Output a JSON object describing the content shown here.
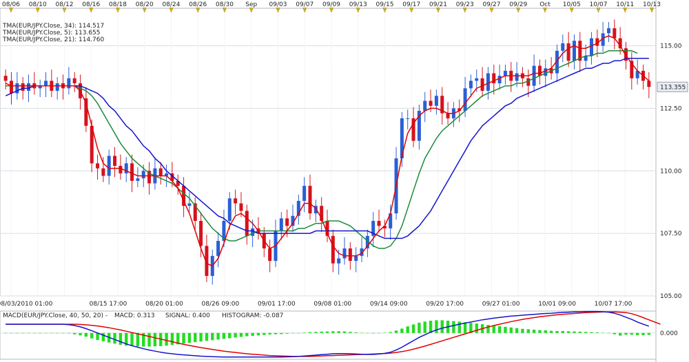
{
  "chart_data": {
    "type": "candlestick",
    "symbol": "EUR/JPY",
    "colors": {
      "up": "#2a5fd6",
      "down": "#d6121c",
      "tma5": "#e00000",
      "tma21": "#1a8a3a",
      "tma34": "#1414cc",
      "macd_line": "#1414cc",
      "signal_line": "#e00000",
      "histogram": "#22dd22",
      "grid": "#d9dde3",
      "marker": "#c8a000"
    },
    "top_axis_labels": [
      "08/06",
      "08/10",
      "08/12",
      "08/16",
      "08/18",
      "08/20",
      "08/24",
      "08/26",
      "08/30",
      "Sep",
      "09/03",
      "09/07",
      "09/09",
      "09/13",
      "09/15",
      "09/17",
      "09/21",
      "09/23",
      "09/27",
      "09/29",
      "Oct",
      "10/05",
      "10/07",
      "10/11",
      "10/13"
    ],
    "bottom_axis_labels": [
      "08/03/2010 01:00",
      "08/15 17:00",
      "08/20 01:00",
      "08/26 09:00",
      "09/01 17:00",
      "09/08 01:00",
      "09/14 09:00",
      "09/20 17:00",
      "09/27 01:00",
      "10/01 09:00",
      "10/07 17:00"
    ],
    "price_axis": {
      "ylim": [
        105,
        116.5
      ],
      "ticks": [
        "115.00",
        "112.50",
        "110.00",
        "107.50",
        "105.00"
      ],
      "tick_values": [
        115,
        112.5,
        110,
        107.5,
        105
      ],
      "last_price": "113.355",
      "last_value": 113.355
    },
    "legend": [
      {
        "text": "TMA(EUR/JPY.Close, 34): 114.517",
        "color": "#1414cc"
      },
      {
        "text": "TMA(EUR/JPY.Close, 5): 113.655",
        "color": "#e00000"
      },
      {
        "text": "TMA(EUR/JPY.Close, 21): 114.760",
        "color": "#1a8a3a"
      }
    ],
    "close": [
      113.6,
      113.1,
      113.5,
      113.2,
      113.5,
      113.3,
      113.4,
      113.6,
      113.2,
      113.5,
      113.3,
      113.7,
      113.5,
      112.9,
      111.8,
      110.3,
      110.1,
      109.8,
      110.6,
      110.2,
      109.9,
      110.3,
      109.6,
      109.7,
      110.0,
      109.5,
      110.1,
      109.8,
      109.9,
      109.6,
      109.4,
      108.6,
      108.7,
      108.0,
      107.0,
      105.8,
      106.6,
      107.2,
      108.0,
      108.9,
      108.7,
      108.4,
      107.4,
      107.7,
      107.5,
      106.9,
      106.4,
      107.6,
      108.1,
      107.8,
      108.2,
      108.8,
      109.4,
      108.3,
      108.6,
      108.0,
      107.4,
      106.3,
      106.5,
      106.9,
      106.4,
      106.6,
      106.9,
      107.4,
      108.0,
      107.8,
      107.7,
      108.3,
      110.5,
      112.1,
      112.1,
      111.2,
      112.4,
      112.8,
      112.6,
      113.0,
      112.3,
      112.1,
      112.5,
      112.4,
      113.3,
      113.6,
      113.7,
      113.2,
      113.9,
      113.5,
      113.8,
      114.0,
      113.6,
      113.9,
      113.7,
      113.4,
      114.2,
      113.8,
      114.1,
      113.9,
      114.8,
      115.1,
      114.4,
      115.2,
      114.4,
      114.6,
      115.3,
      115.0,
      115.5,
      115.7,
      115.3,
      114.9,
      114.4,
      113.7,
      114.0,
      113.6,
      113.355
    ],
    "tma5": [
      113.5,
      113.4,
      113.4,
      113.4,
      113.4,
      113.4,
      113.4,
      113.4,
      113.4,
      113.4,
      113.4,
      113.4,
      113.4,
      113.2,
      112.7,
      111.8,
      110.9,
      110.3,
      110.1,
      110.1,
      110.1,
      110.0,
      109.9,
      109.8,
      109.8,
      109.8,
      109.8,
      109.8,
      109.8,
      109.6,
      109.3,
      108.8,
      108.3,
      107.6,
      106.9,
      106.3,
      106.2,
      106.5,
      107.1,
      107.8,
      108.2,
      108.3,
      108.1,
      107.9,
      107.6,
      107.2,
      106.9,
      107.0,
      107.3,
      107.6,
      107.9,
      108.3,
      108.7,
      108.7,
      108.5,
      108.1,
      107.5,
      107.0,
      106.7,
      106.6,
      106.6,
      106.6,
      106.7,
      107.0,
      107.3,
      107.6,
      107.8,
      108.3,
      109.4,
      110.6,
      111.5,
      111.9,
      112.2,
      112.4,
      112.5,
      112.5,
      112.4,
      112.3,
      112.3,
      112.4,
      112.7,
      113.0,
      113.3,
      113.4,
      113.5,
      113.6,
      113.7,
      113.8,
      113.8,
      113.8,
      113.8,
      113.8,
      113.9,
      113.9,
      114.0,
      114.1,
      114.4,
      114.7,
      114.9,
      115.0,
      114.9,
      114.9,
      115.0,
      115.1,
      115.3,
      115.4,
      115.3,
      115.0,
      114.6,
      114.3,
      114.0,
      113.8,
      113.6
    ],
    "tma21": [
      113.4,
      113.4,
      113.4,
      113.4,
      113.4,
      113.4,
      113.4,
      113.4,
      113.4,
      113.4,
      113.4,
      113.4,
      113.4,
      113.3,
      113.2,
      113.0,
      112.7,
      112.3,
      111.9,
      111.5,
      111.1,
      110.8,
      110.5,
      110.3,
      110.1,
      109.9,
      109.8,
      109.7,
      109.6,
      109.5,
      109.3,
      109.1,
      108.9,
      108.6,
      108.3,
      108.0,
      107.7,
      107.5,
      107.3,
      107.2,
      107.2,
      107.3,
      107.4,
      107.5,
      107.6,
      107.6,
      107.6,
      107.6,
      107.6,
      107.6,
      107.6,
      107.7,
      107.7,
      107.8,
      107.9,
      107.9,
      108.0,
      108.0,
      108.0,
      107.9,
      107.8,
      107.6,
      107.4,
      107.2,
      107.0,
      106.9,
      106.9,
      107.0,
      107.3,
      107.8,
      108.5,
      109.2,
      109.9,
      110.5,
      110.9,
      111.3,
      111.6,
      111.8,
      112.0,
      112.2,
      112.4,
      112.6,
      112.8,
      113.0,
      113.1,
      113.2,
      113.3,
      113.4,
      113.4,
      113.5,
      113.5,
      113.6,
      113.7,
      113.8,
      113.9,
      114.0,
      114.1,
      114.2,
      114.3,
      114.4,
      114.5,
      114.6,
      114.6,
      114.7,
      114.7,
      114.8,
      114.8,
      114.8,
      114.8,
      114.8,
      114.7
    ],
    "tma34": [
      113.0,
      113.1,
      113.2,
      113.3,
      113.3,
      113.4,
      113.4,
      113.4,
      113.4,
      113.4,
      113.4,
      113.4,
      113.4,
      113.4,
      113.3,
      113.2,
      113.1,
      112.9,
      112.6,
      112.4,
      112.1,
      111.8,
      111.6,
      111.3,
      111.0,
      110.8,
      110.5,
      110.3,
      110.0,
      109.8,
      109.6,
      109.4,
      109.2,
      109.0,
      108.8,
      108.6,
      108.4,
      108.2,
      108.1,
      107.9,
      107.8,
      107.7,
      107.6,
      107.6,
      107.5,
      107.5,
      107.5,
      107.5,
      107.5,
      107.5,
      107.5,
      107.5,
      107.5,
      107.5,
      107.6,
      107.6,
      107.6,
      107.6,
      107.6,
      107.6,
      107.6,
      107.6,
      107.6,
      107.6,
      107.5,
      107.4,
      107.3,
      107.3,
      107.3,
      107.3,
      107.4,
      107.6,
      107.8,
      108.1,
      108.4,
      108.8,
      109.2,
      109.6,
      110.0,
      110.4,
      110.8,
      111.2,
      111.5,
      111.8,
      112.0,
      112.2,
      112.4,
      112.6,
      112.7,
      112.9,
      113.0,
      113.1,
      113.2,
      113.3,
      113.4,
      113.5,
      113.6,
      113.7,
      113.8,
      113.9,
      114.0,
      114.1,
      114.1,
      114.2,
      114.3,
      114.3,
      114.4,
      114.4,
      114.5,
      114.5,
      114.5,
      114.5,
      114.5
    ],
    "macd_panel": {
      "legend": [
        {
          "text": "MACD(EUR/JPY.Close, 40, 50, 20) -",
          "color": "#d6121c"
        },
        {
          "text": "MACD: 0.313",
          "color": "#d6121c"
        },
        {
          "text": "SIGNAL: 0.400",
          "color": "#1414cc"
        },
        {
          "text": "HISTOGRAM: -0.087",
          "color": "#22dd22"
        }
      ],
      "zero_label": "0.000",
      "ylim": [
        -1.2,
        1.0
      ],
      "macd": [
        0.4,
        0.4,
        0.4,
        0.4,
        0.4,
        0.4,
        0.4,
        0.4,
        0.4,
        0.4,
        0.4,
        0.38,
        0.34,
        0.28,
        0.2,
        0.1,
        0.0,
        -0.1,
        -0.2,
        -0.3,
        -0.4,
        -0.5,
        -0.58,
        -0.65,
        -0.72,
        -0.78,
        -0.83,
        -0.88,
        -0.92,
        -0.95,
        -0.98,
        -1.0,
        -1.02,
        -1.04,
        -1.06,
        -1.07,
        -1.08,
        -1.09,
        -1.1,
        -1.1,
        -1.1,
        -1.1,
        -1.1,
        -1.1,
        -1.1,
        -1.1,
        -1.1,
        -1.1,
        -1.1,
        -1.09,
        -1.08,
        -1.07,
        -1.05,
        -1.03,
        -1.01,
        -0.99,
        -0.97,
        -0.95,
        -0.94,
        -0.94,
        -0.95,
        -0.96,
        -0.97,
        -0.98,
        -0.98,
        -0.96,
        -0.93,
        -0.88,
        -0.78,
        -0.65,
        -0.5,
        -0.35,
        -0.2,
        -0.08,
        0.04,
        0.14,
        0.22,
        0.28,
        0.34,
        0.4,
        0.45,
        0.5,
        0.55,
        0.6,
        0.64,
        0.68,
        0.71,
        0.74,
        0.77,
        0.79,
        0.81,
        0.83,
        0.85,
        0.87,
        0.89,
        0.9,
        0.92,
        0.94,
        0.95,
        0.96,
        0.97,
        0.98,
        0.98,
        0.98,
        0.97,
        0.95,
        0.9,
        0.82,
        0.72,
        0.62,
        0.5,
        0.4,
        0.313
      ],
      "signal": [
        0.4,
        0.4,
        0.4,
        0.4,
        0.4,
        0.4,
        0.4,
        0.4,
        0.4,
        0.4,
        0.4,
        0.4,
        0.4,
        0.39,
        0.37,
        0.35,
        0.32,
        0.28,
        0.24,
        0.19,
        0.14,
        0.08,
        0.02,
        -0.04,
        -0.1,
        -0.16,
        -0.22,
        -0.28,
        -0.34,
        -0.4,
        -0.46,
        -0.52,
        -0.57,
        -0.62,
        -0.67,
        -0.71,
        -0.75,
        -0.79,
        -0.83,
        -0.86,
        -0.89,
        -0.92,
        -0.95,
        -0.97,
        -0.99,
        -1.01,
        -1.03,
        -1.04,
        -1.05,
        -1.06,
        -1.07,
        -1.07,
        -1.07,
        -1.07,
        -1.06,
        -1.05,
        -1.04,
        -1.03,
        -1.02,
        -1.01,
        -1.0,
        -0.99,
        -0.98,
        -0.97,
        -0.96,
        -0.95,
        -0.94,
        -0.92,
        -0.89,
        -0.85,
        -0.8,
        -0.74,
        -0.67,
        -0.6,
        -0.52,
        -0.44,
        -0.36,
        -0.28,
        -0.2,
        -0.12,
        -0.04,
        0.04,
        0.12,
        0.2,
        0.27,
        0.34,
        0.4,
        0.46,
        0.52,
        0.57,
        0.62,
        0.66,
        0.7,
        0.74,
        0.77,
        0.8,
        0.83,
        0.85,
        0.87,
        0.89,
        0.91,
        0.93,
        0.94,
        0.95,
        0.96,
        0.96,
        0.96,
        0.95,
        0.93,
        0.88,
        0.8,
        0.7,
        0.6,
        0.5,
        0.4
      ],
      "histogram": [
        0,
        0,
        0,
        0,
        0,
        0,
        0,
        0,
        0,
        0,
        0,
        -0.02,
        -0.06,
        -0.11,
        -0.17,
        -0.25,
        -0.32,
        -0.38,
        -0.44,
        -0.49,
        -0.54,
        -0.58,
        -0.6,
        -0.61,
        -0.62,
        -0.62,
        -0.61,
        -0.6,
        -0.58,
        -0.55,
        -0.52,
        -0.48,
        -0.45,
        -0.42,
        -0.39,
        -0.36,
        -0.33,
        -0.3,
        -0.27,
        -0.24,
        -0.21,
        -0.18,
        -0.15,
        -0.13,
        -0.11,
        -0.09,
        -0.07,
        -0.06,
        -0.05,
        -0.03,
        -0.01,
        0.0,
        0.02,
        0.04,
        0.05,
        0.06,
        0.07,
        0.08,
        0.08,
        0.07,
        0.05,
        0.03,
        0.01,
        -0.01,
        -0.02,
        -0.01,
        0.01,
        0.04,
        0.11,
        0.2,
        0.3,
        0.39,
        0.47,
        0.52,
        0.56,
        0.58,
        0.58,
        0.56,
        0.54,
        0.52,
        0.49,
        0.46,
        0.43,
        0.4,
        0.37,
        0.34,
        0.31,
        0.28,
        0.25,
        0.22,
        0.19,
        0.17,
        0.15,
        0.13,
        0.12,
        0.1,
        0.09,
        0.09,
        0.08,
        0.07,
        0.06,
        0.05,
        0.04,
        0.03,
        0.01,
        -0.01,
        -0.06,
        -0.12,
        -0.08,
        -0.08,
        -0.1,
        -0.1,
        -0.087
      ]
    }
  }
}
